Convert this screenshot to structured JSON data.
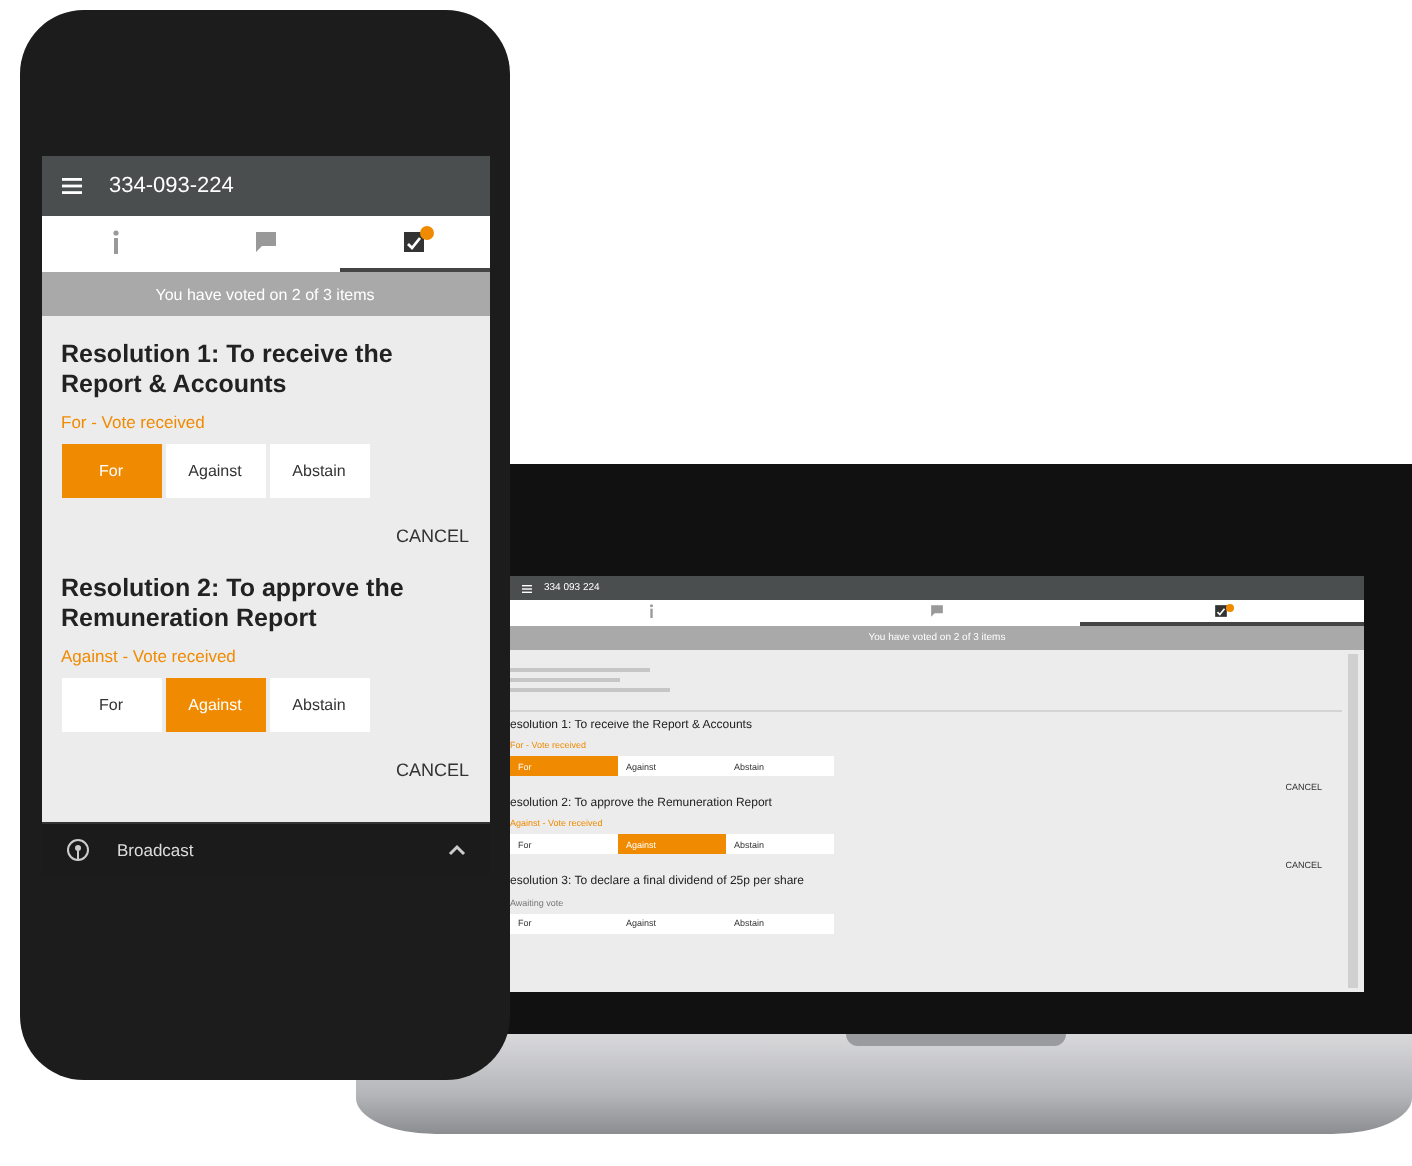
{
  "phone": {
    "app_bar": {
      "title": "334-093-224"
    },
    "tabs": [
      {
        "kind": "info",
        "selected": false,
        "notification": false
      },
      {
        "kind": "chat",
        "selected": false,
        "notification": false
      },
      {
        "kind": "ballot",
        "selected": true,
        "notification": true
      }
    ],
    "banner": "You have voted on 2 of 3 items",
    "resolutions": [
      {
        "title": "Resolution 1: To receive the Report & Accounts",
        "status": "For - Vote received",
        "choices": [
          {
            "label": "For",
            "selected": true
          },
          {
            "label": "Against",
            "selected": false
          },
          {
            "label": "Abstain",
            "selected": false
          }
        ],
        "cancel": "CANCEL"
      },
      {
        "title": "Resolution 2: To approve the Remuneration Report",
        "status": "Against - Vote received",
        "choices": [
          {
            "label": "For",
            "selected": false
          },
          {
            "label": "Against",
            "selected": true
          },
          {
            "label": "Abstain",
            "selected": false
          }
        ],
        "cancel": "CANCEL"
      }
    ],
    "bottom_bar": {
      "label": "Broadcast"
    }
  },
  "laptop": {
    "app_bar": {
      "title": "334 093 224"
    },
    "tabs": [
      {
        "kind": "info",
        "selected": false,
        "notification": false
      },
      {
        "kind": "chat",
        "selected": false,
        "notification": false
      },
      {
        "kind": "ballot",
        "selected": true,
        "notification": true
      }
    ],
    "banner": "You have voted on 2 of 3 items",
    "resolutions": [
      {
        "title": "esolution 1: To receive the Report & Accounts",
        "status": "For - Vote received",
        "choices": [
          {
            "label": "For",
            "selected": true
          },
          {
            "label": "Against",
            "selected": false
          },
          {
            "label": "Abstain",
            "selected": false
          }
        ],
        "cancel": "CANCEL"
      },
      {
        "title": "esolution 2: To approve the Remuneration Report",
        "status": "Against - Vote received",
        "choices": [
          {
            "label": "For",
            "selected": false
          },
          {
            "label": "Against",
            "selected": true
          },
          {
            "label": "Abstain",
            "selected": false
          }
        ],
        "cancel": "CANCEL"
      },
      {
        "title": "esolution 3: To declare a final dividend of 25p per share",
        "status": "Awaiting vote",
        "choices": [
          {
            "label": "For",
            "selected": false
          },
          {
            "label": "Against",
            "selected": false
          },
          {
            "label": "Abstain",
            "selected": false
          }
        ]
      }
    ]
  }
}
